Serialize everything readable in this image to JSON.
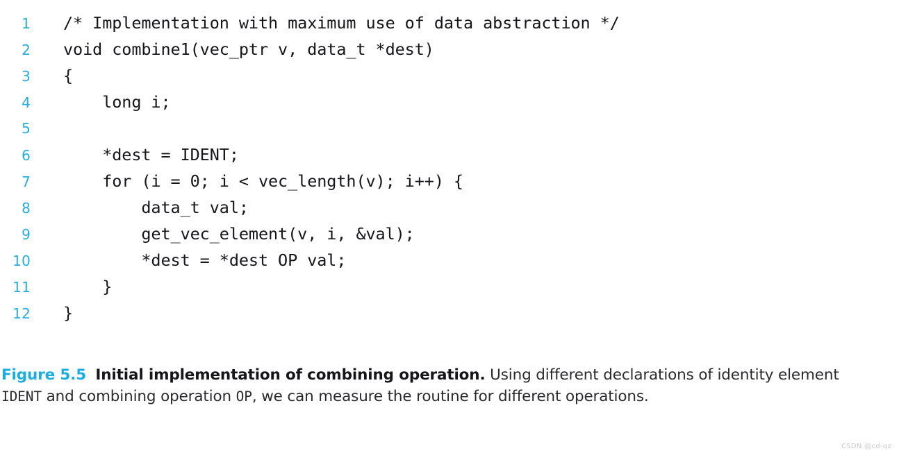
{
  "colors": {
    "accent_cyan": "#22aee5",
    "caption_label_cyan": "#18ade3",
    "code_text": "#16161a",
    "caption_text": "#2a2a2d",
    "background": "#ffffff",
    "watermark": "#c9c9c9"
  },
  "code": {
    "language": "c",
    "lines": [
      {
        "number": "1",
        "text": "/* Implementation with maximum use of data abstraction */"
      },
      {
        "number": "2",
        "text": "void combine1(vec_ptr v, data_t *dest)"
      },
      {
        "number": "3",
        "text": "{"
      },
      {
        "number": "4",
        "text": "    long i;"
      },
      {
        "number": "5",
        "text": ""
      },
      {
        "number": "6",
        "text": "    *dest = IDENT;"
      },
      {
        "number": "7",
        "text": "    for (i = 0; i < vec_length(v); i++) {"
      },
      {
        "number": "8",
        "text": "        data_t val;"
      },
      {
        "number": "9",
        "text": "        get_vec_element(v, i, &val);"
      },
      {
        "number": "10",
        "text": "        *dest = *dest OP val;"
      },
      {
        "number": "11",
        "text": "    }"
      },
      {
        "number": "12",
        "text": "}"
      }
    ]
  },
  "caption": {
    "figure_label": "Figure 5.5",
    "title": "Initial implementation of combining operation.",
    "body_part_1": " Using different declarations of identity element ",
    "mono_1": "IDENT",
    "body_part_2": " and combining operation ",
    "mono_2": "OP",
    "body_part_3": ", we can measure the routine for different operations."
  },
  "watermark": {
    "text": "CSDN @cd-qz"
  }
}
